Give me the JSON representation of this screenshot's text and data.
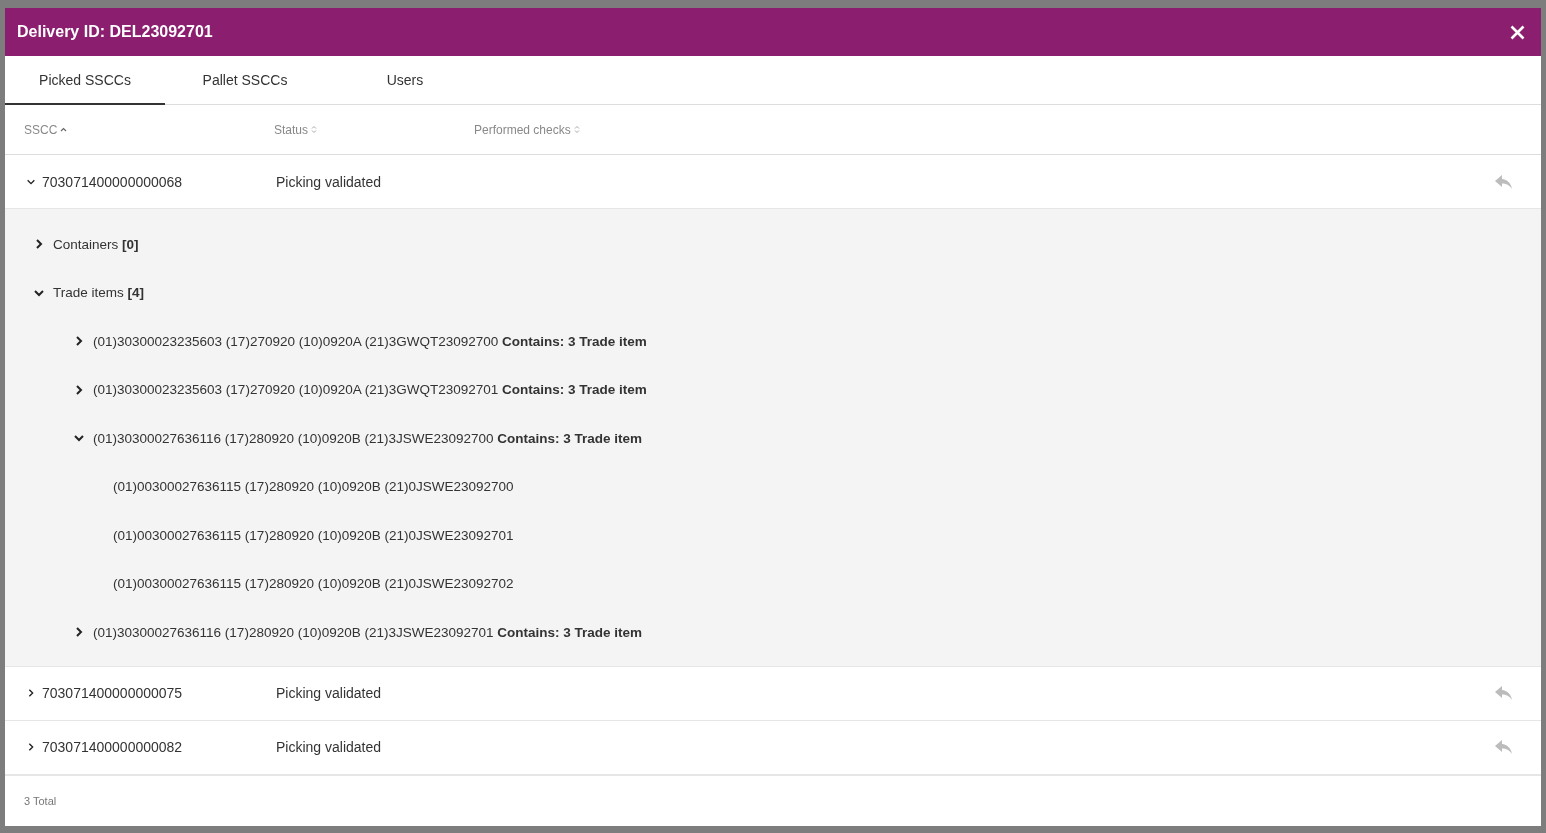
{
  "dialog": {
    "title": "Delivery ID: DEL23092701"
  },
  "tabs": [
    {
      "label": "Picked SSCCs",
      "selected": true
    },
    {
      "label": "Pallet SSCCs",
      "selected": false
    },
    {
      "label": "Users",
      "selected": false
    }
  ],
  "table": {
    "columns": [
      {
        "label": "SSCC",
        "sorted": true
      },
      {
        "label": "Status",
        "sorted": false
      },
      {
        "label": "Performed checks",
        "sorted": false
      }
    ],
    "rows": [
      {
        "sscc": "703071400000000068",
        "status": "Picking validated",
        "expanded": true,
        "children": [
          {
            "label": "Containers **[0]**",
            "expanded": false
          },
          {
            "label": "Trade items **[4]**",
            "expanded": true,
            "children": [
              {
                "label": "(01)30300023235603 (17)270920 (10)0920A (21)3GWQT23092700 **Contains: 3 Trade item**",
                "expanded": false
              },
              {
                "label": "(01)30300023235603 (17)270920 (10)0920A (21)3GWQT23092701 **Contains: 3 Trade item**",
                "expanded": false
              },
              {
                "label": "(01)30300027636116 (17)280920 (10)0920B (21)3JSWE23092700 **Contains: 3 Trade item**",
                "expanded": true,
                "children": [
                  {
                    "label": "(01)00300027636115 (17)280920 (10)0920B (21)0JSWE23092700"
                  },
                  {
                    "label": "(01)00300027636115 (17)280920 (10)0920B (21)0JSWE23092701"
                  },
                  {
                    "label": "(01)00300027636115 (17)280920 (10)0920B (21)0JSWE23092702"
                  }
                ]
              },
              {
                "label": "(01)30300027636116 (17)280920 (10)0920B (21)3JSWE23092701 **Contains: 3 Trade item**",
                "expanded": false
              }
            ]
          }
        ]
      },
      {
        "sscc": "703071400000000075",
        "status": "Picking validated",
        "expanded": false
      },
      {
        "sscc": "703071400000000082",
        "status": "Picking validated",
        "expanded": false
      }
    ]
  },
  "footer": {
    "total": "3 Total"
  }
}
